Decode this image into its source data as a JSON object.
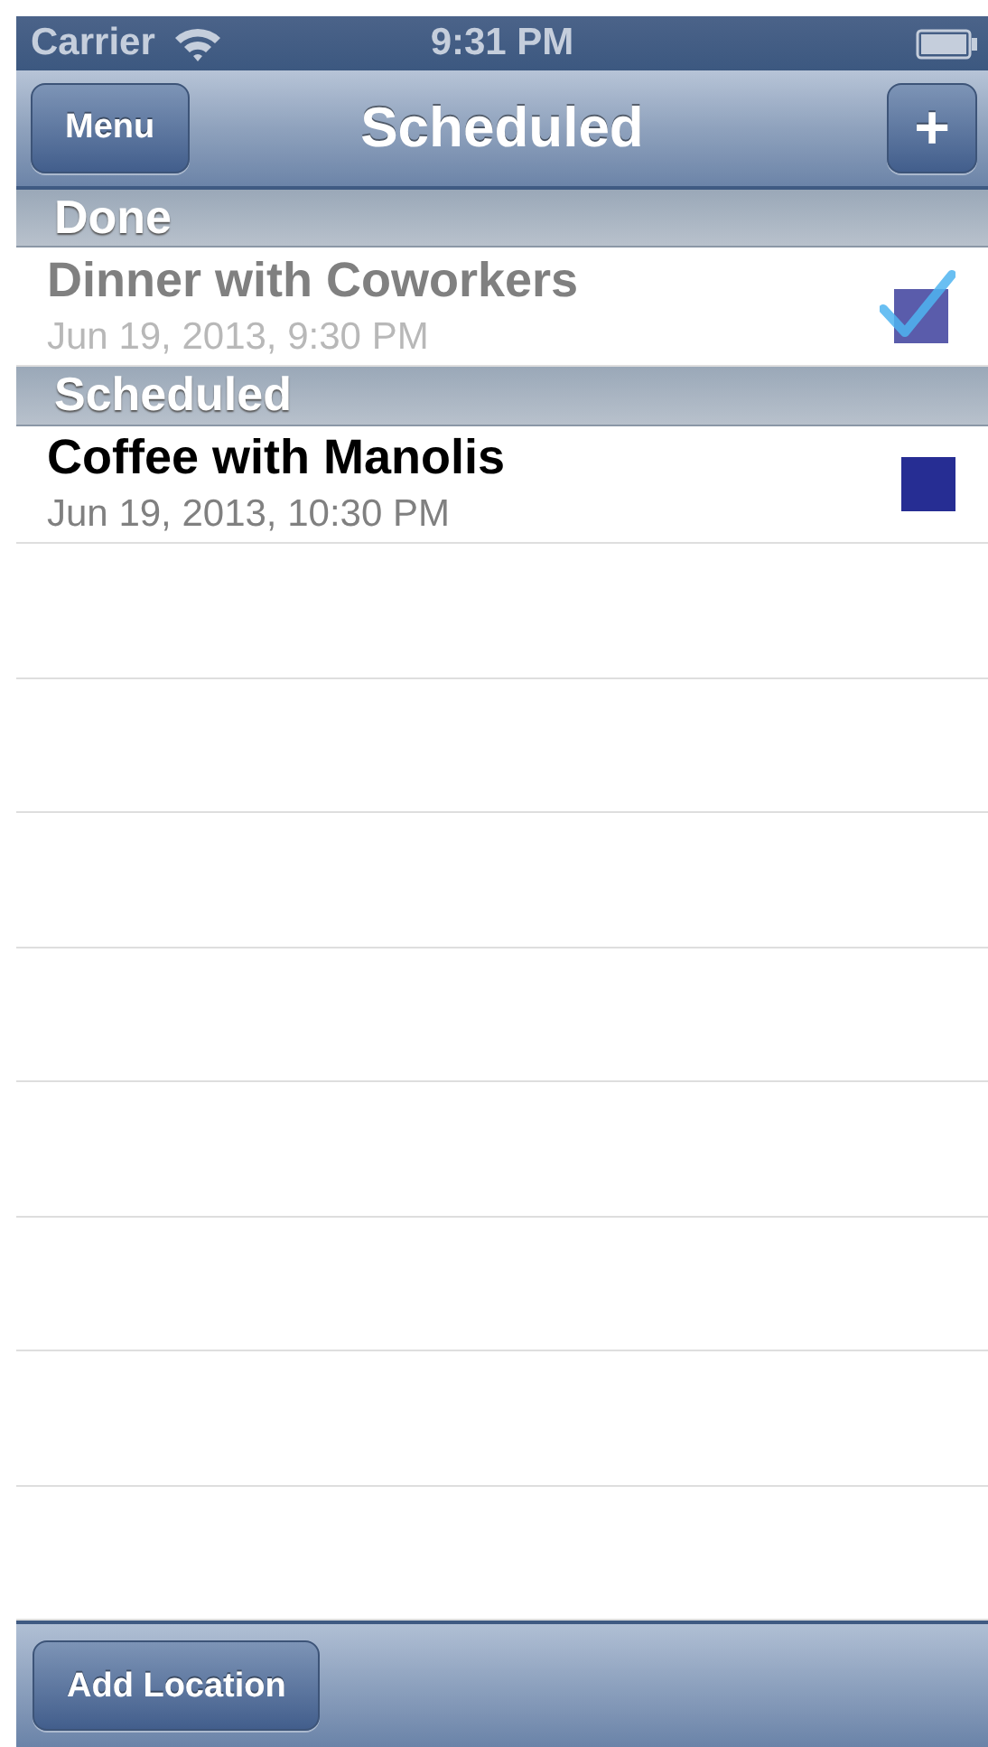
{
  "status_bar": {
    "carrier": "Carrier",
    "time": "9:31 PM"
  },
  "nav_bar": {
    "left_button": "Menu",
    "title": "Scheduled",
    "right_button": "+"
  },
  "sections": [
    {
      "title": "Done",
      "items": [
        {
          "title": "Dinner with Coworkers",
          "date": "Jun 19, 2013, 9:30 PM",
          "checked": true
        }
      ]
    },
    {
      "title": "Scheduled",
      "items": [
        {
          "title": "Coffee with Manolis",
          "date": "Jun 19, 2013, 10:30 PM",
          "checked": false
        }
      ]
    }
  ],
  "toolbar": {
    "button": "Add Location"
  }
}
